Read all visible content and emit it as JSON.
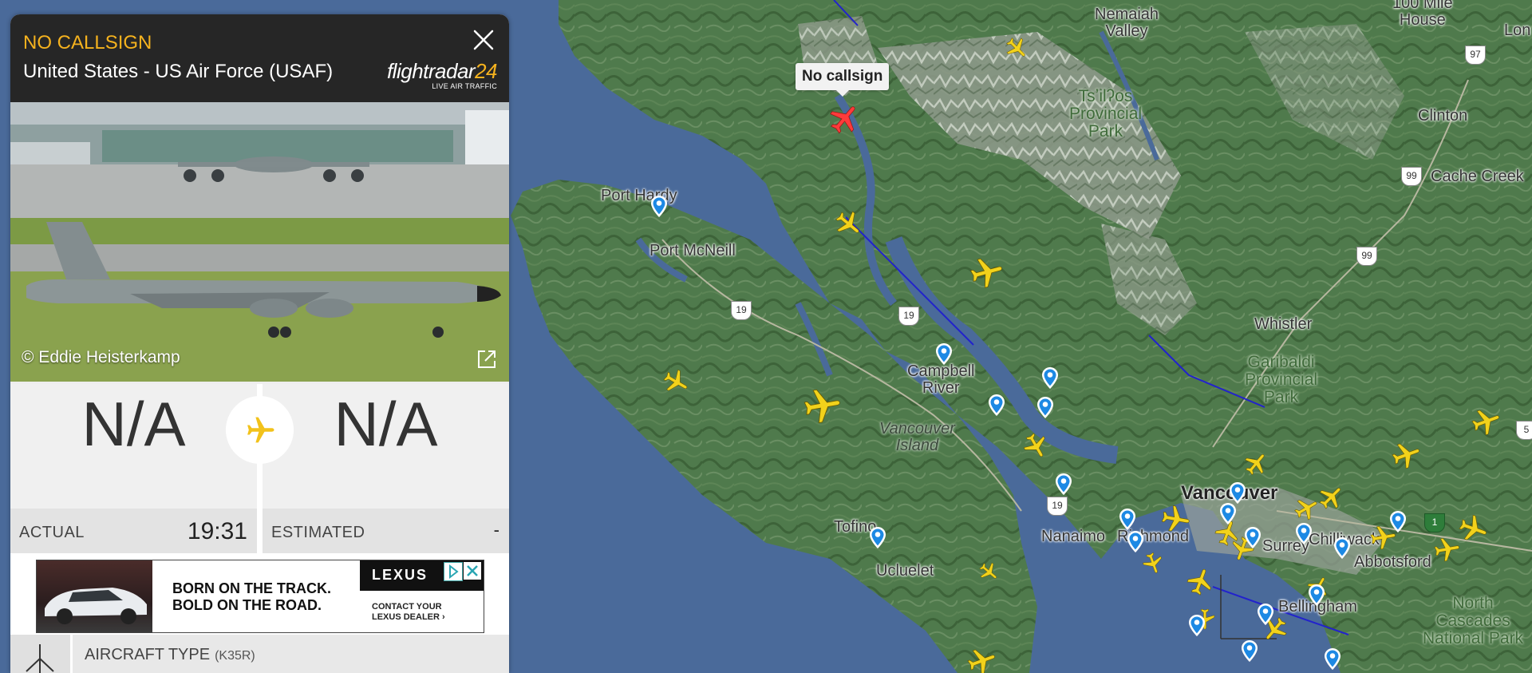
{
  "panel": {
    "callsign": "NO CALLSIGN",
    "operator": "United States - US Air Force (USAF)",
    "logo_text": "flightradar",
    "logo_num": "24",
    "logo_tagline": "LIVE AIR TRAFFIC",
    "photo_credit": "© Eddie Heisterkamp",
    "origin_code": "N/A",
    "destination_code": "N/A",
    "departure_label": "ACTUAL",
    "departure_time": "19:31",
    "arrival_label": "ESTIMATED",
    "arrival_time": "-",
    "aircraft_type_label": "AIRCRAFT TYPE",
    "aircraft_type_code": "(K35R)"
  },
  "ad": {
    "headline_1": "BORN ON THE TRACK.",
    "headline_2": "BOLD ON THE ROAD.",
    "brand": "LEXUS",
    "cta_1": "CONTACT YOUR",
    "cta_2": "LEXUS DEALER ›"
  },
  "map": {
    "selected_callout": "No callsign",
    "labels": {
      "nemaiah": "Nemaiah\nValley",
      "mile100": "100 Mile\nHouse",
      "tsilhqot": "Tsʼilʔos\nProvincial\nPark",
      "clinton": "Clinton",
      "cache": "Cache Creek",
      "porthardy": "Port Hardy",
      "portmcneill": "Port McNeill",
      "whistler": "Whistler",
      "garibaldi": "Garibaldi\nProvincial\nPark",
      "campbell": "Campbell\nRiver",
      "vancouver_island": "Vancouver\nIsland",
      "vancouver": "Vancouver",
      "tofino": "Tofino",
      "ucluelet": "Ucluelet",
      "nanaimo": "Nanaimo",
      "richmond": "Richmond",
      "surrey": "Surrey",
      "chilliwack": "Chilliwack",
      "abbotsford": "Abbotsford",
      "bellingham": "Bellingham",
      "north_cascades": "North\nCascades\nNational Park",
      "lon": "Lon"
    },
    "highway_shields": [
      "97",
      "99",
      "99",
      "19",
      "19",
      "19",
      "5",
      "1"
    ]
  },
  "colors": {
    "accent": "#f5b21e",
    "header_bg": "#262626",
    "plane_selected": "#ff3b3b",
    "water": "#4a6a9a"
  }
}
